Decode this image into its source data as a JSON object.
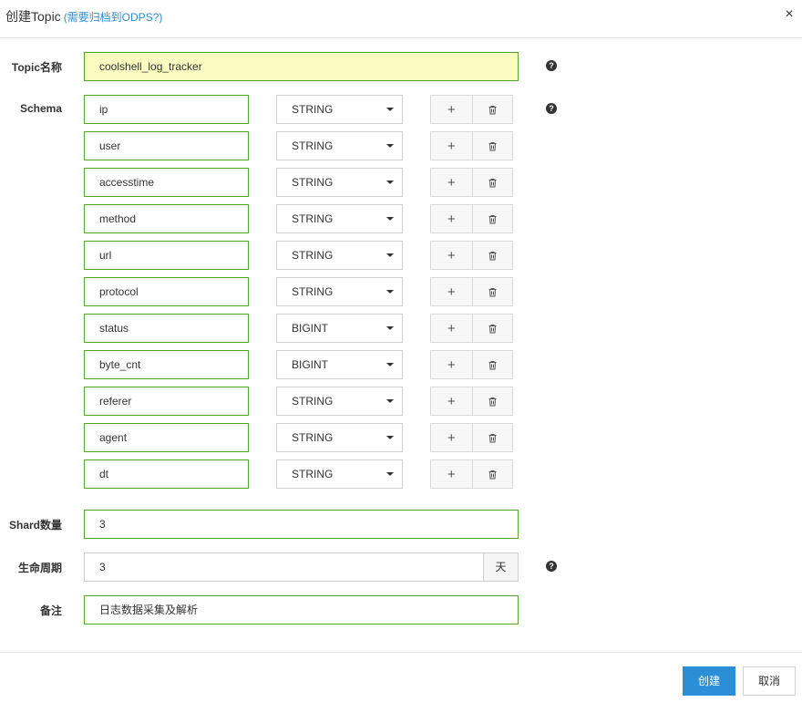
{
  "header": {
    "title": "创建Topic",
    "archive_link": "(需要归档到ODPS?)",
    "close_label": "×"
  },
  "form": {
    "topic_name": {
      "label": "Topic名称",
      "value": "coolshell_log_tracker"
    },
    "schema": {
      "label": "Schema",
      "add_label": "+",
      "fields": [
        {
          "name": "ip",
          "type": "STRING"
        },
        {
          "name": "user",
          "type": "STRING"
        },
        {
          "name": "accesstime",
          "type": "STRING"
        },
        {
          "name": "method",
          "type": "STRING"
        },
        {
          "name": "url",
          "type": "STRING"
        },
        {
          "name": "protocol",
          "type": "STRING"
        },
        {
          "name": "status",
          "type": "BIGINT"
        },
        {
          "name": "byte_cnt",
          "type": "BIGINT"
        },
        {
          "name": "referer",
          "type": "STRING"
        },
        {
          "name": "agent",
          "type": "STRING"
        },
        {
          "name": "dt",
          "type": "STRING"
        }
      ]
    },
    "shard_count": {
      "label": "Shard数量",
      "value": "3"
    },
    "lifecycle": {
      "label": "生命周期",
      "value": "3",
      "unit": "天"
    },
    "remark": {
      "label": "备注",
      "value": "日志数据采集及解析"
    }
  },
  "footer": {
    "create_label": "创建",
    "cancel_label": "取消"
  },
  "colors": {
    "accent": "#2a8fd6",
    "valid_border": "#57a32b",
    "highlight_bg": "#fbfdc0"
  }
}
